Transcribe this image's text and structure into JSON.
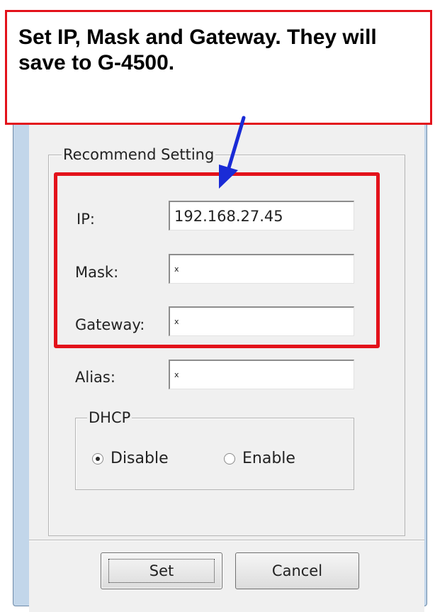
{
  "annotation": {
    "text": "Set IP, Mask and Gateway. They will save to G-4500."
  },
  "recommend_group": {
    "title": "Recommend Setting"
  },
  "fields": {
    "ip": {
      "label": "IP:",
      "value": "192.168.27.45"
    },
    "mask": {
      "label": "Mask:",
      "value": "x"
    },
    "gateway": {
      "label": "Gateway:",
      "value": "x"
    },
    "alias": {
      "label": "Alias:",
      "value": "x"
    }
  },
  "dhcp_group": {
    "title": "DHCP",
    "options": [
      {
        "label": "Disable",
        "selected": true
      },
      {
        "label": "Enable",
        "selected": false
      }
    ]
  },
  "buttons": {
    "set_label": "Set",
    "cancel_label": "Cancel"
  },
  "colors": {
    "annotation_red": "#e3121b",
    "arrow_blue": "#1a2bd6",
    "window_frame": "#c2d6ea",
    "dialog_bg": "#f0f0f0"
  }
}
